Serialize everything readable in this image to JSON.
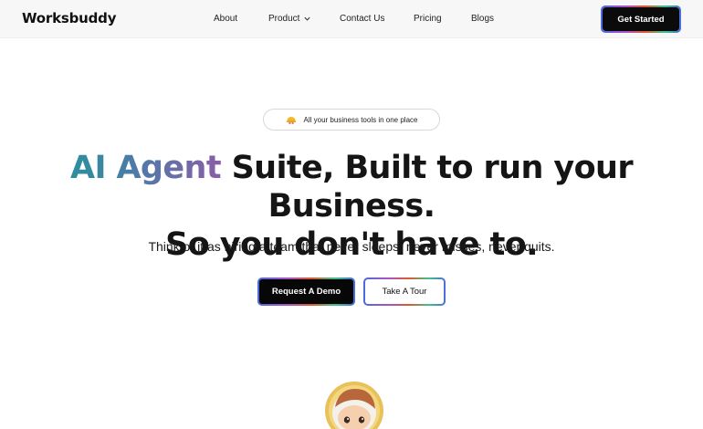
{
  "header": {
    "logo": "Worksbuddy",
    "nav": [
      {
        "label": "About"
      },
      {
        "label": "Product"
      },
      {
        "label": "Contact Us"
      },
      {
        "label": "Pricing"
      },
      {
        "label": "Blogs"
      }
    ],
    "cta_label": "Get Started"
  },
  "hero": {
    "badge_icon": "hardhat-emoji-icon",
    "badge_text": "All your business tools in one place",
    "headline_accent": "AI Agent",
    "headline_rest": " Suite, Built to run your Business.",
    "headline_line2": "So you don't have to.",
    "subheadline": "Think of it as hiring a team that never sleeps, never misses, never quits.",
    "primary_button": "Request A Demo",
    "secondary_button": "Take A Tour",
    "mascot_icon": "astronaut-mascot"
  },
  "colors": {
    "accent_gradient": [
      "#2b8f9c",
      "#4f7aa8",
      "#8a5ea6"
    ],
    "button_dark": "#0b0b0b",
    "border_gradient": [
      "#4b6bdc",
      "#a455c9",
      "#e0582f",
      "#3cc28c"
    ]
  }
}
